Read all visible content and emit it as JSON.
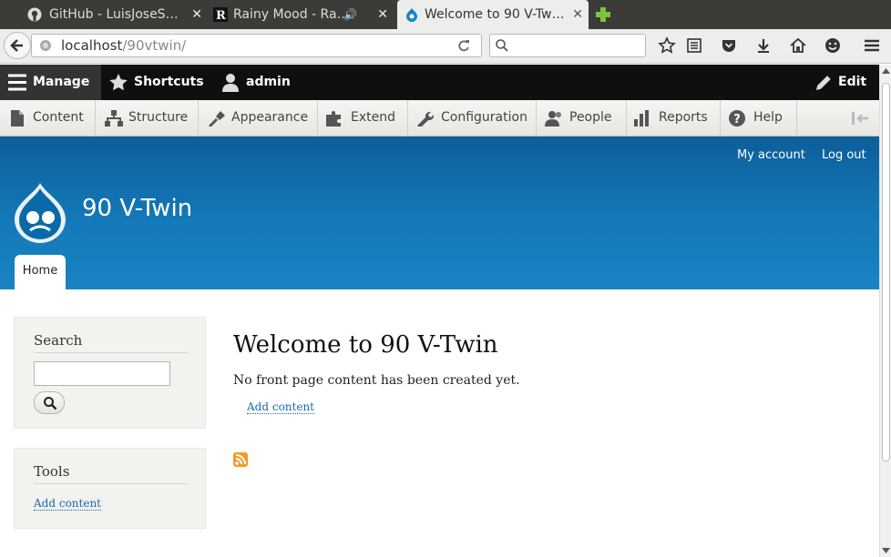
{
  "browser": {
    "tabs": [
      {
        "title": "GitHub - LuisJoseSa…",
        "icon": "github-icon"
      },
      {
        "title": "Rainy Mood - Rai…",
        "icon": "rainymood-icon"
      },
      {
        "title": "Welcome to 90 V-Tw…",
        "icon": "drupal-icon"
      }
    ],
    "url_host": "localhost",
    "url_path": "/90vtwin/"
  },
  "toolbar": {
    "manage": "Manage",
    "shortcuts": "Shortcuts",
    "user": "admin",
    "edit": "Edit"
  },
  "tray": {
    "items": [
      {
        "label": "Content",
        "icon": "content-icon"
      },
      {
        "label": "Structure",
        "icon": "structure-icon"
      },
      {
        "label": "Appearance",
        "icon": "appearance-icon"
      },
      {
        "label": "Extend",
        "icon": "extend-icon"
      },
      {
        "label": "Configuration",
        "icon": "configuration-icon"
      },
      {
        "label": "People",
        "icon": "people-icon"
      },
      {
        "label": "Reports",
        "icon": "reports-icon"
      },
      {
        "label": "Help",
        "icon": "help-icon"
      }
    ]
  },
  "header": {
    "my_account": "My account",
    "log_out": "Log out",
    "site_name": "90 V-Twin",
    "home_tab": "Home"
  },
  "sidebar": {
    "search_title": "Search",
    "tools_title": "Tools",
    "tools_link": "Add content"
  },
  "main": {
    "title": "Welcome to 90 V-Twin",
    "message": "No front page content has been created yet.",
    "add_content": "Add content"
  },
  "colors": {
    "header_blue": "#1479b8",
    "link_blue": "#1a68b0",
    "toolbar_black": "#0f0f0f",
    "rss_orange": "#f29b28"
  }
}
